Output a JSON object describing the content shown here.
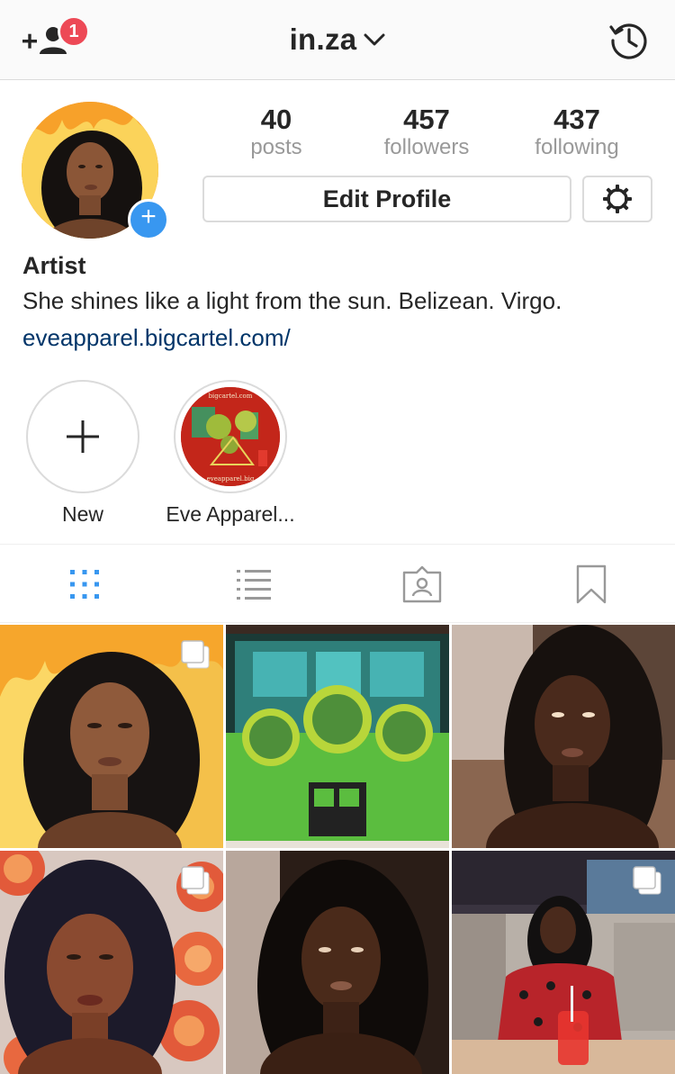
{
  "header": {
    "username": "in.za",
    "notification_count": "1"
  },
  "profile": {
    "stats": [
      {
        "value": "40",
        "label": "posts"
      },
      {
        "value": "457",
        "label": "followers"
      },
      {
        "value": "437",
        "label": "following"
      }
    ],
    "edit_button_label": "Edit Profile",
    "bio": {
      "name": "Artist",
      "text": "She shines like a light from the sun. Belizean. Virgo.",
      "link": "eveapparel.bigcartel.com/"
    }
  },
  "highlights": [
    {
      "label": "New"
    },
    {
      "label": "Eve Apparel...",
      "cover_text_top": "bigcartel.com",
      "cover_text_bottom": "eveapparel.big"
    }
  ],
  "tabs": [
    "grid",
    "list",
    "tagged",
    "saved"
  ],
  "active_tab": "grid",
  "colors": {
    "accent": "#3897f0",
    "badge": "#ed4956",
    "link": "#003569",
    "muted": "#999999"
  },
  "posts": [
    {
      "subject": "portrait-flames",
      "multiple": true
    },
    {
      "subject": "painting-green-figures",
      "multiple": false
    },
    {
      "subject": "portrait-dim",
      "multiple": false
    },
    {
      "subject": "portrait-roses",
      "multiple": true
    },
    {
      "subject": "portrait-dark",
      "multiple": false
    },
    {
      "subject": "portrait-restaurant",
      "multiple": true
    }
  ]
}
